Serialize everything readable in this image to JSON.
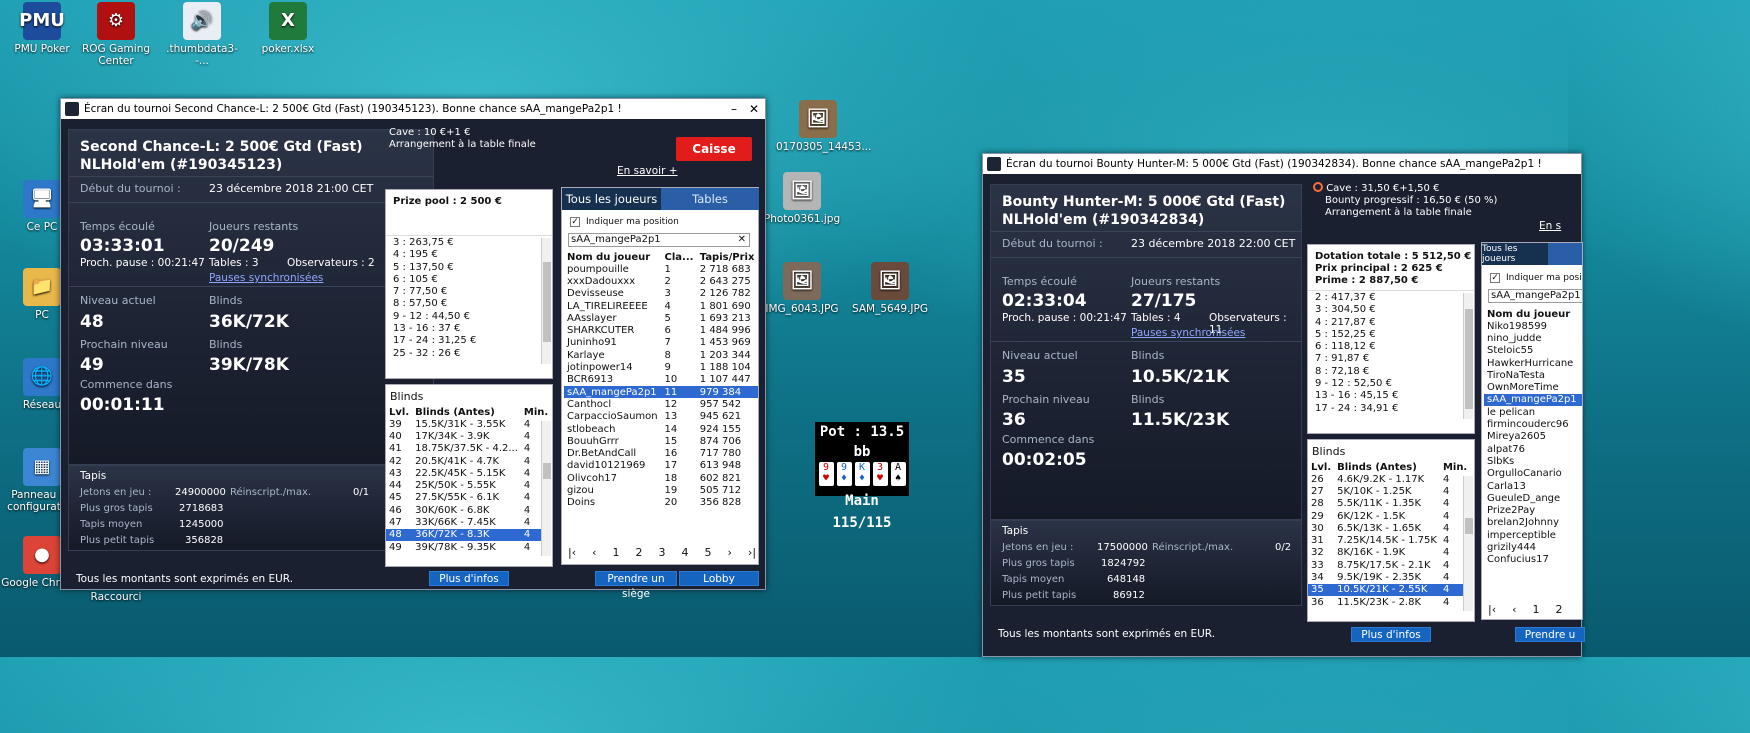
{
  "desktop_icons": [
    {
      "label": "PMU Poker",
      "glyph": "PMU",
      "color": "#1d4c9c"
    },
    {
      "label": "ROG Gaming Center",
      "glyph": "⚙",
      "color": "#b01010"
    },
    {
      "label": ".thumbdata3--...",
      "glyph": "🔊",
      "color": "#e9eef5"
    },
    {
      "label": "poker.xlsx",
      "glyph": "X",
      "color": "#1f7a3c"
    },
    {
      "label": "Ce PC",
      "glyph": "🖥",
      "color": "#2d78c9"
    },
    {
      "label": "PC",
      "glyph": "📁",
      "color": "#e8b84a"
    },
    {
      "label": "Réseau",
      "glyph": "🌐",
      "color": "#2d78c9"
    },
    {
      "label": "Panneau de configuration",
      "glyph": "▦",
      "color": "#3d86d4"
    },
    {
      "label": "Google Chrome",
      "glyph": "●",
      "color": "#db4437"
    },
    {
      "label": "Raccourci",
      "glyph": "",
      "color": "#1f2f4a"
    },
    {
      "label": "0170305_14453...",
      "glyph": "🖼",
      "color": "#8a6d4a"
    },
    {
      "label": "Photo0361.jpg",
      "glyph": "🖼",
      "color": "#b5b5b5"
    },
    {
      "label": "IMG_6043.JPG",
      "glyph": "🖼",
      "color": "#7d6a5a"
    },
    {
      "label": "SAM_5649.JPG",
      "glyph": "🖼",
      "color": "#6a4a3a"
    }
  ],
  "hud": {
    "pot": "Pot : 13.5 bb",
    "hand": "Main 115/115",
    "cards": [
      {
        "rank": "9",
        "suit": "♥",
        "color": "#d40000"
      },
      {
        "rank": "9",
        "suit": "♦",
        "color": "#1a5fd4"
      },
      {
        "rank": "K",
        "suit": "♦",
        "color": "#1a5fd4"
      },
      {
        "rank": "3",
        "suit": "♥",
        "color": "#d40000"
      },
      {
        "rank": "A",
        "suit": "♠",
        "color": "#000000"
      }
    ]
  },
  "win1": {
    "title": "Écran du tournoi Second Chance-L: 2 500€ Gtd (Fast) (190345123). Bonne chance sAA_mangePa2p1 !",
    "name_line1": "Second Chance-L: 2 500€ Gtd (Fast)",
    "name_line2": "NLHold'em (#190345123)",
    "debut_label": "Début du tournoi :",
    "debut_value": "23 décembre 2018   21:00 CET",
    "temps_label": "Temps écoulé",
    "temps_value": "03:33:01",
    "pause": "Proch. pause : 00:21:47",
    "joueurs_label": "Joueurs restants",
    "joueurs_value": "20/249",
    "tables": "Tables : 3",
    "observateurs": "Observateurs :  2",
    "pauses_sync": "Pauses synchronisées",
    "niveau_label": "Niveau actuel",
    "niveau_value": "48",
    "blinds_label": "Blinds",
    "blinds_value": "36K/72K",
    "prochain_label": "Prochain niveau",
    "prochain_value": "49",
    "blinds2_label": "Blinds",
    "blinds2_value": "39K/78K",
    "commence_label": "Commence dans",
    "commence_value": "00:01:11",
    "tapis_title": "Tapis",
    "jetons_label": "Jetons en jeu :",
    "jetons_value": "24900000",
    "reinscript_label": "Réinscript./max.",
    "reinscript_value": "0/1",
    "gros_label": "Plus gros tapis",
    "gros_value": "2718683",
    "moyen_label": "Tapis moyen",
    "moyen_value": "1245000",
    "petit_label": "Plus petit tapis",
    "petit_value": "356828",
    "footer": "Tous les montants sont exprimés en EUR.",
    "cave": "Cave : 10 €+1 €",
    "arrangement": "Arrangement à la table finale",
    "caisse": "Caisse",
    "en_savoir": "En savoir +",
    "prize_title": "Prize pool : 2 500 €",
    "prizes": [
      "3 : 263,75 €",
      "4 : 195 €",
      "5 : 137,50 €",
      "6 : 105 €",
      "7 : 77,50 €",
      "8 : 57,50 €",
      "9 - 12 : 44,50 €",
      "13 - 16 : 37 €",
      "17 - 24 : 31,25 €",
      "25 - 32 : 26 €"
    ],
    "blinds_title": "Blinds",
    "blinds_headers": [
      "Lvl.",
      "Blinds (Antes)",
      "Min."
    ],
    "blinds_rows": [
      [
        "39",
        "15.5K/31K - 3.55K",
        "4"
      ],
      [
        "40",
        "17K/34K - 3.9K",
        "4"
      ],
      [
        "41",
        "18.75K/37.5K - 4.2...",
        "4"
      ],
      [
        "42",
        "20.5K/41K - 4.7K",
        "4"
      ],
      [
        "43",
        "22.5K/45K - 5.15K",
        "4"
      ],
      [
        "44",
        "25K/50K - 5.55K",
        "4"
      ],
      [
        "45",
        "27.5K/55K - 6.1K",
        "4"
      ],
      [
        "46",
        "30K/60K - 6.8K",
        "4"
      ],
      [
        "47",
        "33K/66K - 7.45K",
        "4"
      ],
      [
        "48",
        "36K/72K - 8.3K",
        "4"
      ],
      [
        "49",
        "39K/78K - 9.35K",
        "4"
      ]
    ],
    "tab_players": "Tous les joueurs",
    "tab_tables": "Tables",
    "indiquer": "Indiquer ma position",
    "search_value": "sAA_mangePa2p1",
    "players_headers": [
      "Nom du joueur",
      "Cla...",
      "Tapis/Prix"
    ],
    "players": [
      [
        "poumpouille",
        "1",
        "2 718 683"
      ],
      [
        "xxxDadouxxx",
        "2",
        "2 643 275"
      ],
      [
        "Devisseuse",
        "3",
        "2 126 782"
      ],
      [
        "LA_TIRELIREEEE",
        "4",
        "1 801 690"
      ],
      [
        "AAsslayer",
        "5",
        "1 693 213"
      ],
      [
        "SHARKCUTER",
        "6",
        "1 484 996"
      ],
      [
        "Juninho91",
        "7",
        "1 453 969"
      ],
      [
        "Karlaye",
        "8",
        "1 203 344"
      ],
      [
        "jotinpower14",
        "9",
        "1 188 104"
      ],
      [
        "BCR6913",
        "10",
        "1 107 447"
      ],
      [
        "sAA_mangePa2p1",
        "11",
        "979 384"
      ],
      [
        "Canthocl",
        "12",
        "957 542"
      ],
      [
        "CarpaccioSaumon",
        "13",
        "945 621"
      ],
      [
        "stlobeach",
        "14",
        "924 155"
      ],
      [
        "BouuhGrrr",
        "15",
        "874 706"
      ],
      [
        "Dr.BetAndCall",
        "16",
        "717 780"
      ],
      [
        "david10121969",
        "17",
        "613 948"
      ],
      [
        "Olivcoh17",
        "18",
        "602 821"
      ],
      [
        "gizou",
        "19",
        "505 712"
      ],
      [
        "Doins",
        "20",
        "356 828"
      ]
    ],
    "pages": [
      "1",
      "2",
      "3",
      "4",
      "5"
    ],
    "plus_infos": "Plus d'infos",
    "prendre": "Prendre un siège",
    "lobby": "Lobby"
  },
  "win2": {
    "title": "Écran du tournoi Bounty Hunter-M: 5 000€ Gtd (Fast) (190342834). Bonne chance sAA_mangePa2p1 !",
    "name_line1": "Bounty Hunter-M: 5 000€ Gtd (Fast)",
    "name_line2": "NLHold'em (#190342834)",
    "debut_label": "Début du tournoi :",
    "debut_value": "23 décembre 2018   22:00 CET",
    "temps_label": "Temps écoulé",
    "temps_value": "02:33:04",
    "pause": "Proch. pause : 00:21:47",
    "joueurs_label": "Joueurs restants",
    "joueurs_value": "27/175",
    "tables": "Tables : 4",
    "observateurs": "Observateurs :  11",
    "pauses_sync": "Pauses synchronisées",
    "niveau_label": "Niveau actuel",
    "niveau_value": "35",
    "blinds_label": "Blinds",
    "blinds_value": "10.5K/21K",
    "prochain_label": "Prochain niveau",
    "prochain_value": "36",
    "blinds2_label": "Blinds",
    "blinds2_value": "11.5K/23K",
    "commence_label": "Commence dans",
    "commence_value": "00:02:05",
    "tapis_title": "Tapis",
    "jetons_label": "Jetons en jeu :",
    "jetons_value": "17500000",
    "reinscript_label": "Réinscript./max.",
    "reinscript_value": "0/2",
    "gros_label": "Plus gros tapis",
    "gros_value": "1824792",
    "moyen_label": "Tapis moyen",
    "moyen_value": "648148",
    "petit_label": "Plus petit tapis",
    "petit_value": "86912",
    "footer": "Tous les montants sont exprimés en EUR.",
    "cave": "Cave : 31,50 €+1,50 €",
    "bounty": "Bounty progressif : 16,50 € (50 %)",
    "arrangement": "Arrangement à la table finale",
    "en_savoir": "En s",
    "dotation": "Dotation totale : 5 512,50 €",
    "prix_principal": "Prix principal : 2 625 €",
    "prime": "Prime : 2 887,50 €",
    "prizes": [
      "2 : 417,37 €",
      "3 : 304,50 €",
      "4 : 217,87 €",
      "5 : 152,25 €",
      "6 : 118,12 €",
      "7 : 91,87 €",
      "8 : 72,18 €",
      "9 - 12 : 52,50 €",
      "13 - 16 : 45,15 €",
      "17 - 24 : 34,91 €"
    ],
    "blinds_title": "Blinds",
    "blinds_headers": [
      "Lvl.",
      "Blinds (Antes)",
      "Min."
    ],
    "blinds_rows": [
      [
        "26",
        "4.6K/9.2K - 1.17K",
        "4"
      ],
      [
        "27",
        "5K/10K - 1.25K",
        "4"
      ],
      [
        "28",
        "5.5K/11K - 1.35K",
        "4"
      ],
      [
        "29",
        "6K/12K - 1.5K",
        "4"
      ],
      [
        "30",
        "6.5K/13K - 1.65K",
        "4"
      ],
      [
        "31",
        "7.25K/14.5K - 1.75K",
        "4"
      ],
      [
        "32",
        "8K/16K - 1.9K",
        "4"
      ],
      [
        "33",
        "8.75K/17.5K - 2.1K",
        "4"
      ],
      [
        "34",
        "9.5K/19K - 2.35K",
        "4"
      ],
      [
        "35",
        "10.5K/21K - 2.55K",
        "4"
      ],
      [
        "36",
        "11.5K/23K - 2.8K",
        "4"
      ]
    ],
    "tab_players": "Tous les joueurs",
    "indiquer": "Indiquer ma positi",
    "search_value": "sAA_mangePa2p1",
    "players_header": "Nom du joueur",
    "players": [
      "Niko198599",
      "nino_judde",
      "Steloic55",
      "HawkerHurricane",
      "TiroNaTesta",
      "OwnMoreTime",
      "sAA_mangePa2p1",
      "le pelican",
      "firmincouderc96",
      "Mireya2605",
      "alpat76",
      "SlbKs",
      "OrgulloCanario",
      "Carla13",
      "GueuleD_ange",
      "Prize2Pay",
      "brelan2Johnny",
      "imperceptible",
      "grizily444",
      "Confucius17"
    ],
    "pages": [
      "1",
      "2"
    ],
    "plus_infos": "Plus d'infos",
    "prendre": "Prendre u"
  }
}
